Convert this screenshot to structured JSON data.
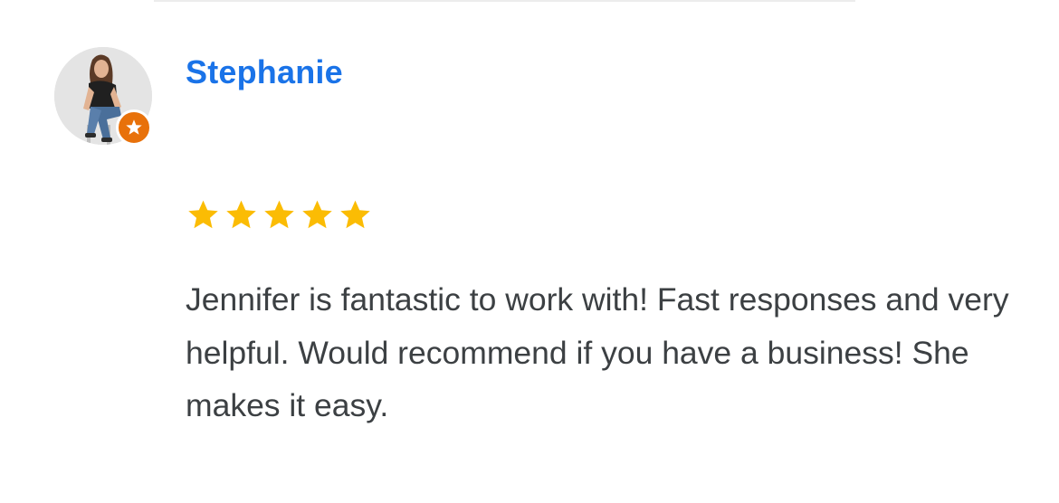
{
  "review": {
    "reviewer_name": "Stephanie",
    "avatar_icon": "person-photo-icon",
    "badge_icon": "local-guide-star-icon",
    "rating": 5,
    "rating_max": 5,
    "star_color": "#fbbc04",
    "text": "Jennifer is fantastic to work with! Fast responses and very helpful. Would recommend if you have a business! She makes it easy."
  },
  "colors": {
    "name": "#1a73e8",
    "text": "#3c4043",
    "badge": "#e8710a"
  }
}
